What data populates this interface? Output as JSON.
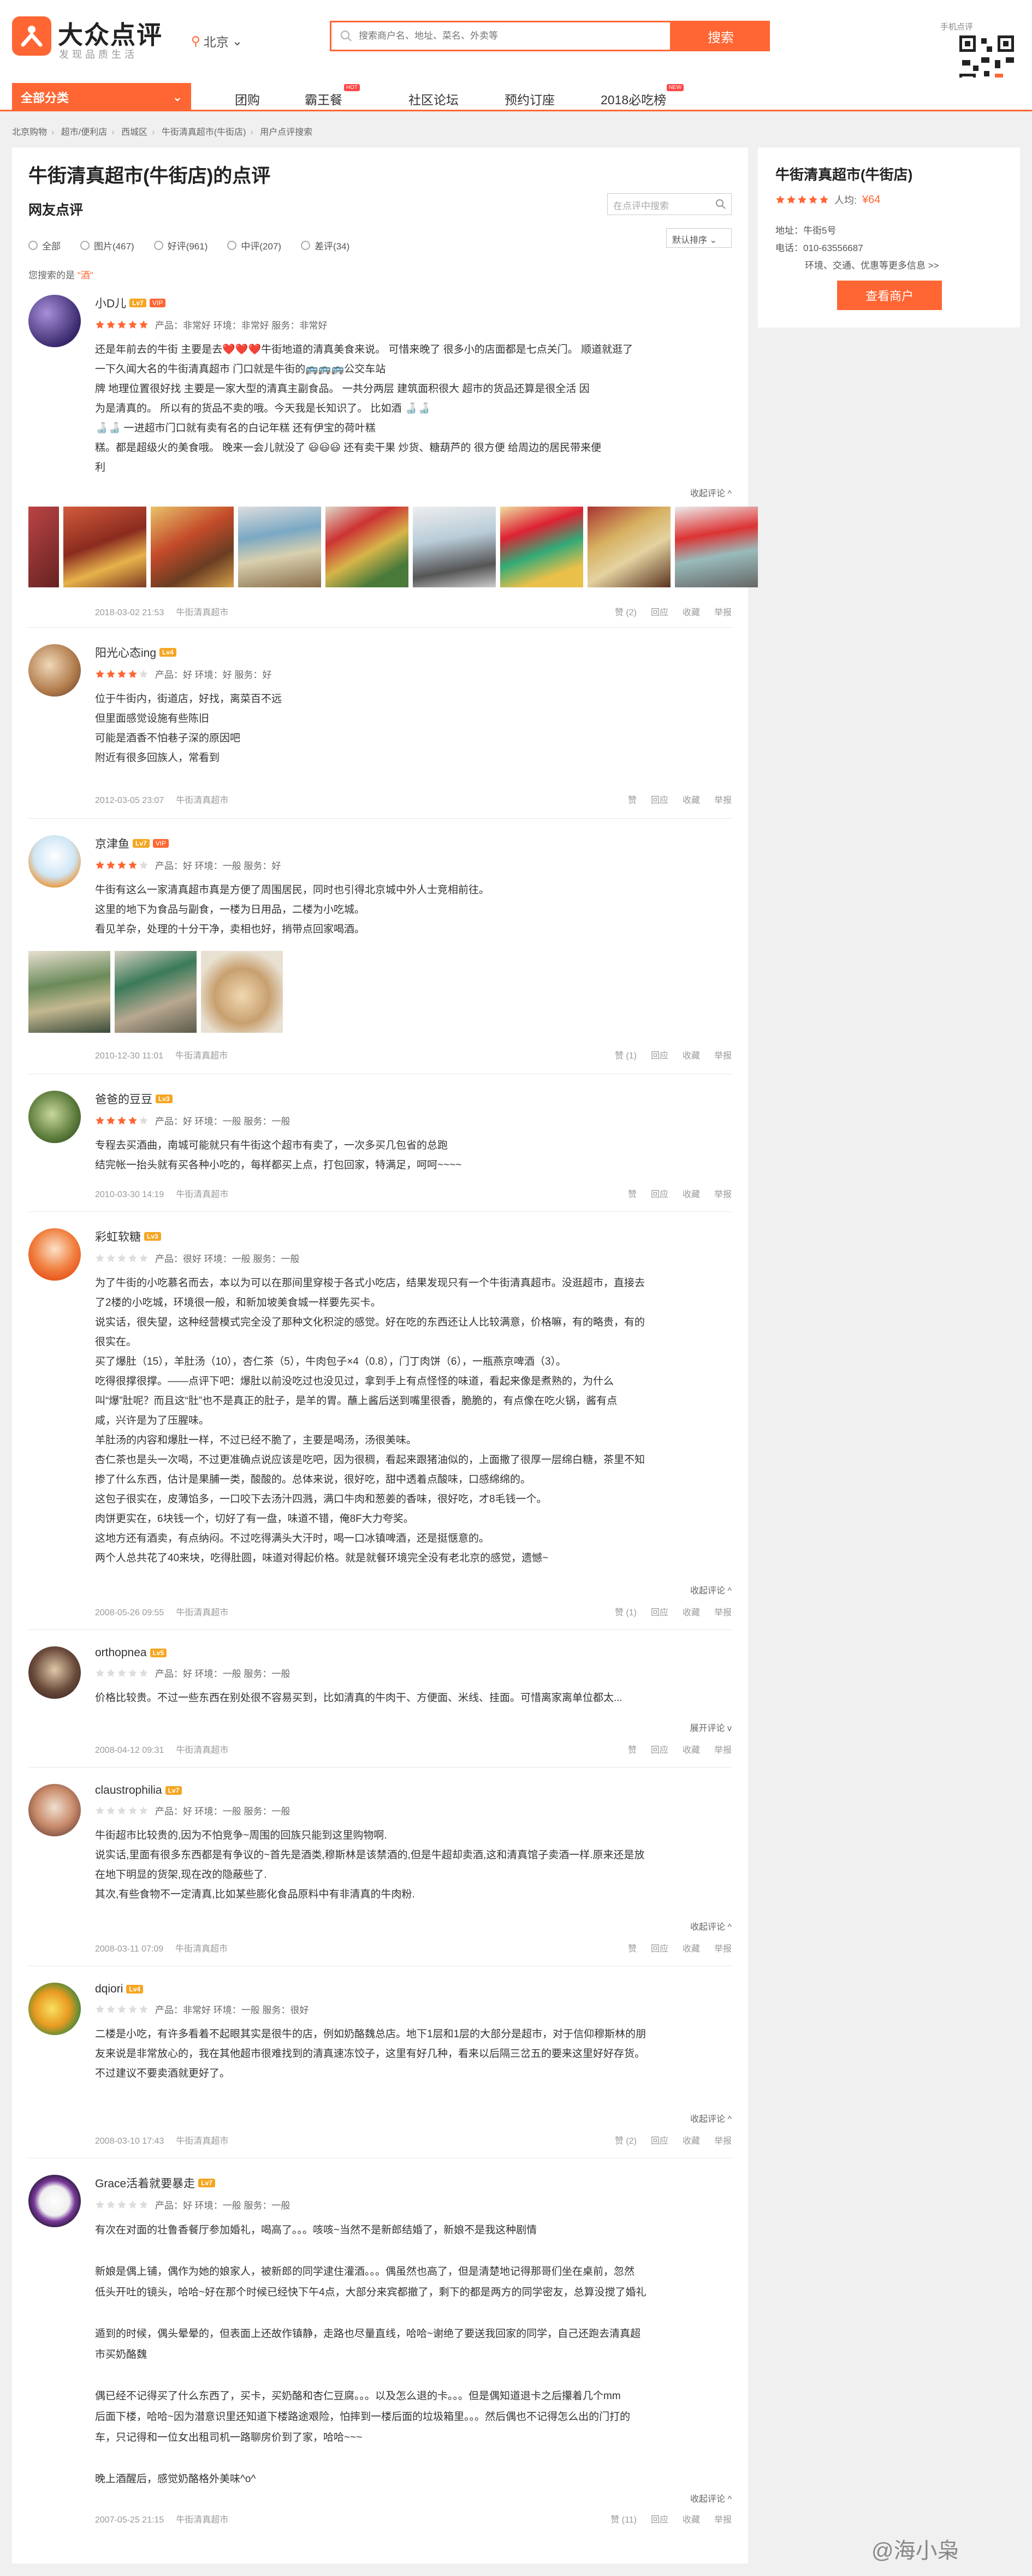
{
  "header": {
    "brand_name": "大众点评",
    "brand_slogan": "发现品质生活",
    "city": "北京",
    "search_placeholder": "搜索商户名、地址、菜名、外卖等",
    "search_button": "搜索",
    "qr_label": "手机点评"
  },
  "nav": {
    "all_categories": "全部分类",
    "items": [
      {
        "label": "团购",
        "hot": ""
      },
      {
        "label": "霸王餐",
        "hot": "HOT"
      },
      {
        "label": "社区论坛",
        "hot": ""
      },
      {
        "label": "预约订座",
        "hot": ""
      },
      {
        "label": "2018必吃榜",
        "hot": "NEW"
      }
    ]
  },
  "breadcrumb": [
    "北京购物",
    "超市/便利店",
    "西城区",
    "牛街清真超市(牛街店)",
    "用户点评搜索"
  ],
  "main": {
    "title": "牛街清真超市(牛街店)的点评",
    "section": "网友点评",
    "inner_search_placeholder": "在点评中搜索",
    "filters": [
      "全部",
      "图片(467)",
      "好评(961)",
      "中评(207)",
      "差评(34)"
    ],
    "sort": "默认排序",
    "search_hint_prefix": "您搜索的是",
    "search_keyword": "\"酒\""
  },
  "reviews": [
    {
      "user": "小D儿",
      "lv": "Lv7",
      "vip": "VIP",
      "stars": 5,
      "scores": "产品：非常好  环境：非常好  服务：非常好",
      "lines": [
        "还是年前去的牛街  主要是去❤️❤️❤️牛街地道的清真美食来说。  可惜来晚了  很多小的店面都是七点关门。  顺道就逛了",
        "一下久闻大名的牛街清真超市                                                                   门口就是牛街的🚌🚌🚌公交车站",
        "牌  地理位置很好找  主要是一家大型的清真主副食品。  一共分两层      建筑面积很大        超市的货品还算是很全活   因",
        "为是清真的。    所以有的货品不卖的哦。今天我是长知识了。    比如酒 🍶🍶",
        "🍶🍶                                                             一进超市门口就有卖有名的白记年糕      还有伊宝的荷叶糕",
        "糕。都是超级火的美食哦。  晚来一会儿就没了 😃😃😃      还有卖干果  炒货、糖葫芦的  很方便    给周边的居民带来便",
        "利"
      ],
      "collapse": "收起评论 ^",
      "date": "2018-03-02 21:53",
      "shop": "牛街清真超市",
      "actions": [
        "赞 (2)",
        "回应",
        "收藏",
        "举报"
      ]
    },
    {
      "user": "阳光心态ing",
      "lv": "Lv4",
      "vip": "",
      "stars": 4,
      "scores": "产品：好  环境：好  服务：好",
      "lines": [
        "位于牛街内，街道店，好找，离菜百不远",
        "但里面感觉设施有些陈旧",
        "可能是酒香不怕巷子深的原因吧",
        "附近有很多回族人，常看到"
      ],
      "date": "2012-03-05 23:07",
      "shop": "牛街清真超市",
      "actions": [
        "赞",
        "回应",
        "收藏",
        "举报"
      ]
    },
    {
      "user": "京津鱼",
      "lv": "Lv7",
      "vip": "VIP",
      "stars": 4,
      "scores": "产品：好  环境：一般  服务：好",
      "lines": [
        "牛街有这么一家清真超市真是方便了周围居民，同时也引得北京城中外人士竞相前往。",
        "这里的地下为食品与副食，一楼为日用品，二楼为小吃城。",
        "看见羊杂，处理的十分干净，卖相也好，捎带点回家喝酒。"
      ],
      "date": "2010-12-30 11:01",
      "shop": "牛街清真超市",
      "actions": [
        "赞 (1)",
        "回应",
        "收藏",
        "举报"
      ]
    },
    {
      "user": "爸爸的豆豆",
      "lv": "Lv3",
      "vip": "",
      "stars": 4,
      "scores": "产品：好  环境：一般  服务：一般",
      "lines": [
        "专程去买酒曲，南城可能就只有牛街这个超市有卖了，一次多买几包省的总跑",
        "结完帐一抬头就有买各种小吃的，每样都买上点，打包回家，特满足，呵呵~~~~"
      ],
      "date": "2010-03-30 14:19",
      "shop": "牛街清真超市",
      "actions": [
        "赞",
        "回应",
        "收藏",
        "举报"
      ]
    },
    {
      "user": "彩虹软糖",
      "lv": "Lv3",
      "vip": "",
      "stars": 0,
      "scores": "产品：很好  环境：一般  服务：一般",
      "lines": [
        "为了牛街的小吃慕名而去，本以为可以在那间里穿梭于各式小吃店，结果发现只有一个牛街清真超市。没逛超市，直接去",
        "了2楼的小吃城，环境很一般，和新加坡美食城一样要先买卡。",
        "说实话，很失望，这种经营模式完全没了那种文化积淀的感觉。好在吃的东西还让人比较满意，价格嘛，有的略贵，有的",
        "很实在。",
        "买了爆肚（15），羊肚汤（10），杏仁茶（5），牛肉包子×4（0.8），门丁肉饼（6），一瓶燕京啤酒（3）。",
        "吃得很撑很撑。——点评下吧：爆肚以前没吃过也没见过，拿到手上有点怪怪的味道，看起来像是煮熟的，为什么",
        "叫“爆”肚呢？而且这“肚”也不是真正的肚子，是羊的胃。蘸上酱后送到嘴里很香，脆脆的，有点像在吃火锅，酱有点",
        "咸，兴许是为了压腥味。",
        "羊肚汤的内容和爆肚一样，不过已经不脆了，主要是喝汤，汤很美味。",
        "杏仁茶也是头一次喝，不过更准确点说应该是吃吧，因为很稠，看起来跟猪油似的，上面撒了很厚一层绵白糖，茶里不知",
        "掺了什么东西，估计是果脯一类，酸酸的。总体来说，很好吃，甜中透着点酸味，口感绵绵的。",
        "这包子很实在，皮薄馅多，一口咬下去汤汁四溅，满口牛肉和葱姜的香味，很好吃，才8毛钱一个。",
        "肉饼更实在，6块钱一个，切好了有一盘，味道不错，俺8F大力夸奖。",
        "这地方还有酒卖，有点纳闷。不过吃得满头大汗时，喝一口冰镇啤酒，还是挺惬意的。",
        "两个人总共花了40来块，吃得肚圆，味道对得起价格。就是就餐环境完全没有老北京的感觉，遗憾~"
      ],
      "collapse": "收起评论 ^",
      "date": "2008-05-26 09:55",
      "shop": "牛街清真超市",
      "actions": [
        "赞 (1)",
        "回应",
        "收藏",
        "举报"
      ]
    },
    {
      "user": "orthopnea",
      "lv": "Lv5",
      "vip": "",
      "stars": 0,
      "scores": "产品：好  环境：一般  服务：一般",
      "lines": [
        "价格比较贵。不过一些东西在别处很不容易买到，比如清真的牛肉干、方便面、米线、挂面。可惜离家离单位都太..."
      ],
      "collapse": "展开评论 v",
      "date": "2008-04-12 09:31",
      "shop": "牛街清真超市",
      "actions": [
        "赞",
        "回应",
        "收藏",
        "举报"
      ]
    },
    {
      "user": "claustrophilia",
      "lv": "Lv7",
      "vip": "",
      "stars": 0,
      "scores": "产品：好  环境：一般  服务：一般",
      "lines": [
        "牛街超市比较贵的,因为不怕竞争~周围的回族只能到这里购物啊.",
        "说实话,里面有很多东西都是有争议的~首先是酒类,穆斯林是该禁酒的,但是牛超却卖酒,这和清真馆子卖酒一样.原来还是放",
        "在地下明显的货架,现在改的隐蔽些了.",
        "其次,有些食物不一定清真,比如某些膨化食品原料中有非清真的牛肉粉."
      ],
      "collapse": "收起评论 ^",
      "date": "2008-03-11 07:09",
      "shop": "牛街清真超市",
      "actions": [
        "赞",
        "回应",
        "收藏",
        "举报"
      ]
    },
    {
      "user": "dqiori",
      "lv": "Lv4",
      "vip": "",
      "stars": 0,
      "scores": "产品：非常好  环境：一般  服务：很好",
      "lines": [
        "二楼是小吃，有许多看着不起眼其实是很牛的店，例如奶酪魏总店。地下1层和1层的大部分是超市，对于信仰穆斯林的朋",
        "友来说是非常放心的，我在其他超市很难找到的清真速冻饺子，这里有好几种，看来以后隔三岔五的要来这里好好存货。",
        "不过建议不要卖酒就更好了。"
      ],
      "collapse": "收起评论 ^",
      "date": "2008-03-10 17:43",
      "shop": "牛街清真超市",
      "actions": [
        "赞 (2)",
        "回应",
        "收藏",
        "举报"
      ]
    },
    {
      "user": "Grace活着就要暴走",
      "lv": "Lv7",
      "vip": "",
      "stars": 0,
      "scores": "产品：好  环境：一般  服务：一般",
      "lines": [
        "有次在对面的壮鲁香餐厅参加婚礼，喝高了。。。咳咳~当然不是新郎结婚了，新娘不是我这种剧情",
        "",
        "新娘是偶上铺，偶作为她的娘家人，被新郎的同学逮住灌酒。。。偶虽然也高了，但是清楚地记得那哥们坐在桌前，忽然",
        "低头开吐的镜头，哈哈~好在那个时候已经快下午4点，大部分来宾都撤了，剩下的都是两方的同学密友，总算没搅了婚礼",
        "",
        "遁到的时候，偶头晕晕的，但表面上还故作镇静，走路也尽量直线，哈哈~谢绝了要送我回家的同学，自己还跑去清真超",
        "市买奶酪魏",
        "",
        "偶已经不记得买了什么东西了，买卡，买奶酪和杏仁豆腐。。。以及怎么退的卡。。。但是偶知道退卡之后攥着几个mm",
        "后面下楼，哈哈~因为潜意识里还知道下楼路途艰险，怕摔到一楼后面的垃圾箱里。。。然后偶也不记得怎么出的门打的",
        "车，只记得和一位女出租司机一路聊房价到了家，哈哈~~~",
        "",
        "晚上酒醒后，感觉奶酪格外美味^o^"
      ],
      "collapse": "收起评论 ^",
      "date": "2007-05-25 21:15",
      "shop": "牛街清真超市",
      "actions": [
        "赞 (11)",
        "回应",
        "收藏",
        "举报"
      ]
    }
  ],
  "sidebar": {
    "title": "牛街清真超市(牛街店)",
    "stars": 5,
    "per_capita": "人均:",
    "price": "¥64",
    "address": "地址：牛街5号",
    "phone": "电话：010-63556687",
    "tags": "环境、交通、优惠等更多信息 >>",
    "button": "查看商户"
  },
  "watermark": "@海小枭",
  "colors": {
    "accent": "#ff6633",
    "star": "#ff6633",
    "star_empty": "#dddddd"
  }
}
